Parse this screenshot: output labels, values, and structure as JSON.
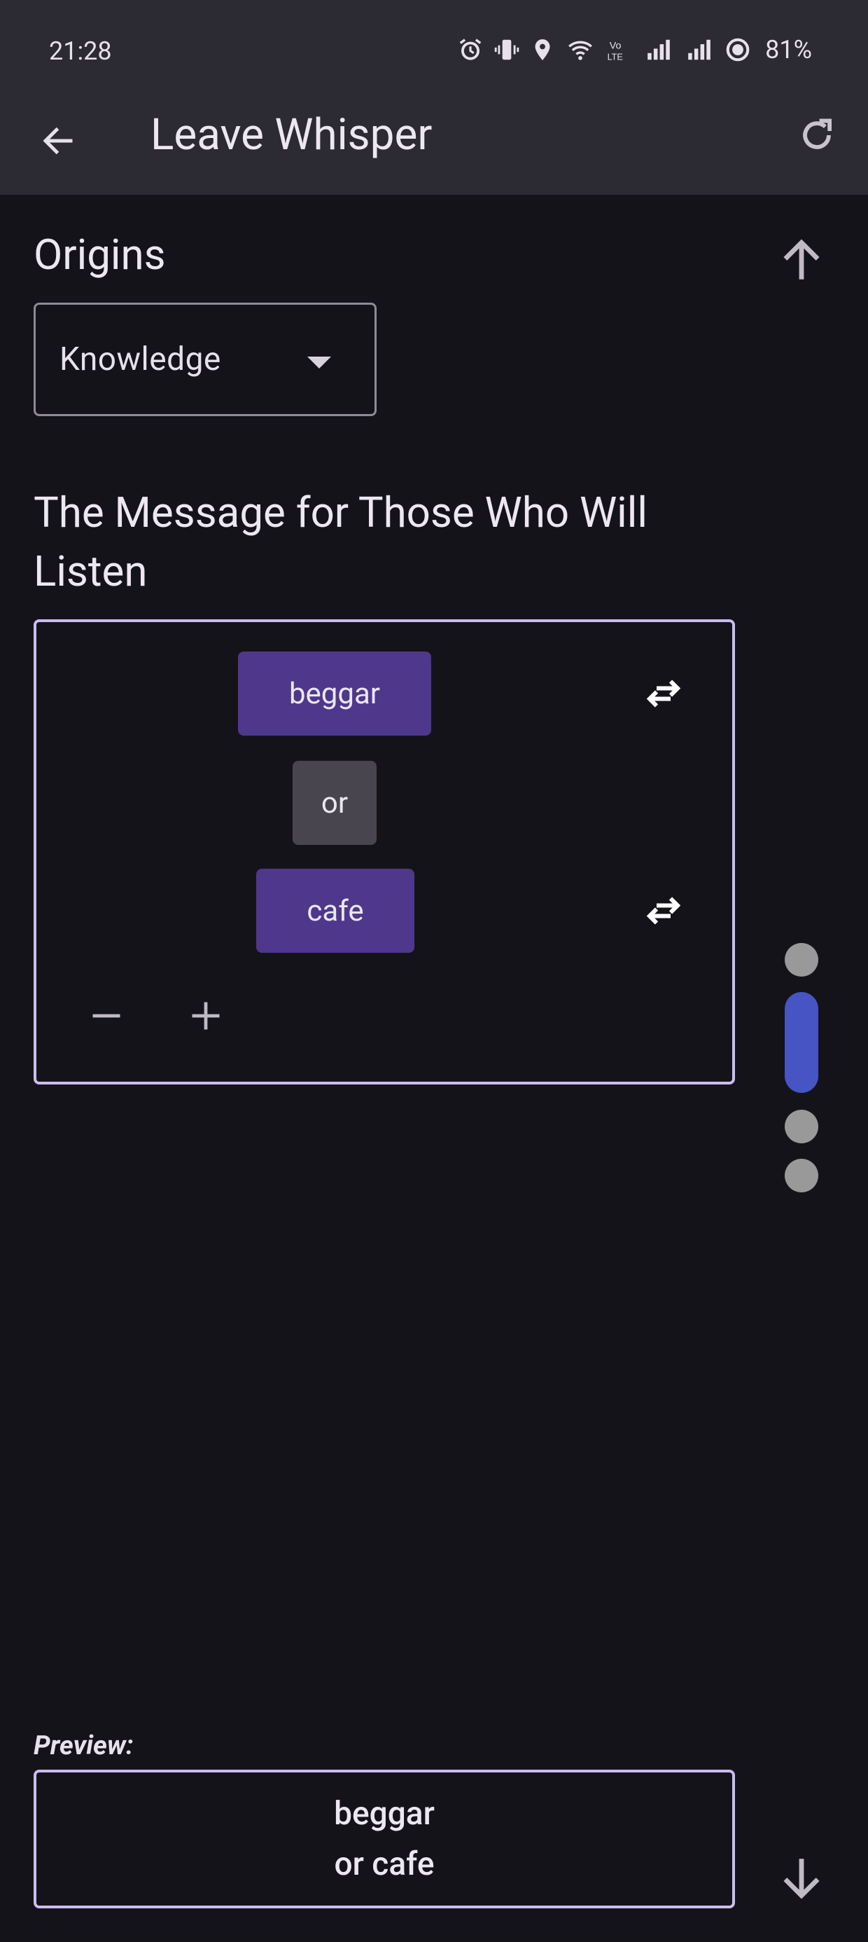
{
  "status_bar": {
    "time": "21:28",
    "battery_percent": "81%",
    "icons": [
      "alarm-icon",
      "vibrate-icon",
      "location-icon",
      "wifi-icon",
      "volte-icon",
      "signal-icon",
      "signal-icon",
      "battery-ring-icon"
    ]
  },
  "app_bar": {
    "back_icon": "arrow-back-icon",
    "title": "Leave Whisper",
    "refresh_icon": "refresh-icon"
  },
  "origins": {
    "heading": "Origins",
    "dropdown_value": "Knowledge"
  },
  "message": {
    "heading": "The Message for Those Who Will Listen",
    "words": [
      {
        "label": "beggar",
        "kind": "word"
      },
      {
        "label": "or",
        "kind": "conjunction"
      },
      {
        "label": "cafe",
        "kind": "word"
      }
    ],
    "remove_label": "−",
    "add_label": "+"
  },
  "page_indicator": {
    "count": 4,
    "active_index": 1
  },
  "preview": {
    "label": "Preview:",
    "line1": "beggar",
    "line2": "or cafe"
  },
  "colors": {
    "background": "#15131a",
    "appbar": "#2c2a33",
    "chip_primary": "#4f378b",
    "chip_secondary": "#49454f",
    "outline": "#c9bdf2",
    "indicator_active": "#4654c4",
    "indicator_inactive": "#999999"
  }
}
